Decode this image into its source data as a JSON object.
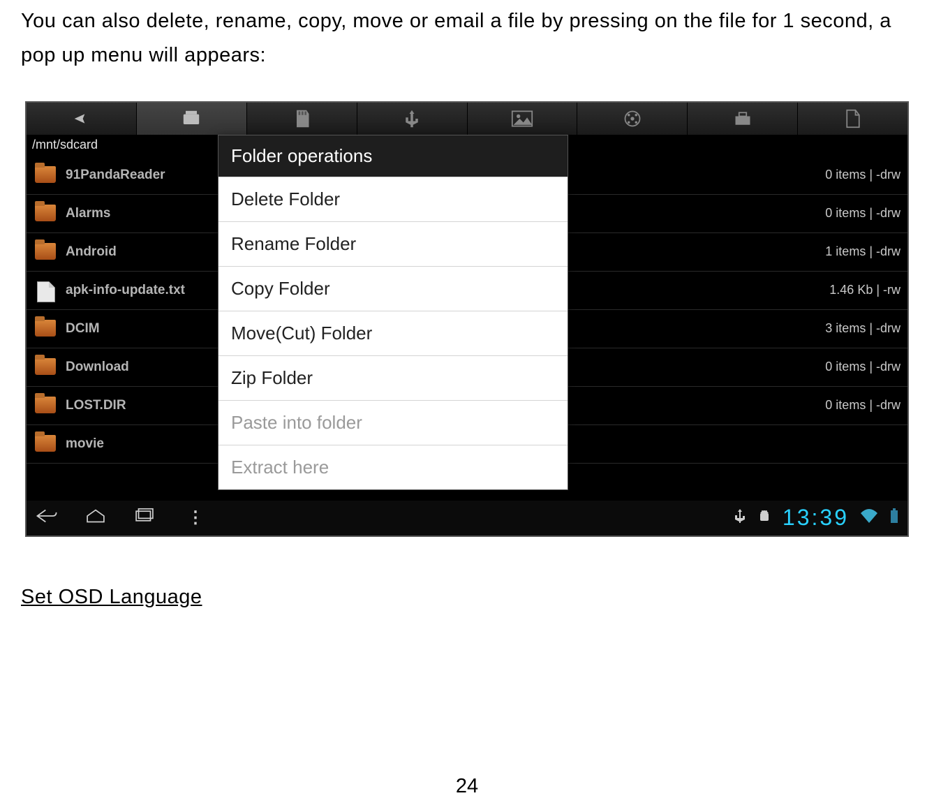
{
  "doc": {
    "body_text": "You can also delete, rename, copy, move or email a file by pressing on the file for 1 second, a pop up menu will appears:",
    "section_heading": "Set OSD Language",
    "page_number": "24"
  },
  "screenshot": {
    "path": "/mnt/sdcard",
    "clock": "13:39",
    "files": [
      {
        "name": "91PandaReader",
        "meta": "0 items | -drw",
        "type": "folder"
      },
      {
        "name": "Alarms",
        "meta": "0 items | -drw",
        "type": "folder"
      },
      {
        "name": "Android",
        "meta": "1 items | -drw",
        "type": "folder"
      },
      {
        "name": "apk-info-update.txt",
        "meta": "1.46 Kb  | -rw",
        "type": "file"
      },
      {
        "name": "DCIM",
        "meta": "3 items | -drw",
        "type": "folder"
      },
      {
        "name": "Download",
        "meta": "0 items | -drw",
        "type": "folder"
      },
      {
        "name": "LOST.DIR",
        "meta": "0 items | -drw",
        "type": "folder"
      },
      {
        "name": "movie",
        "meta": "",
        "type": "folder"
      }
    ],
    "popup": {
      "title": "Folder operations",
      "items": [
        {
          "label": "Delete Folder",
          "enabled": true
        },
        {
          "label": "Rename Folder",
          "enabled": true
        },
        {
          "label": "Copy Folder",
          "enabled": true
        },
        {
          "label": "Move(Cut) Folder",
          "enabled": true
        },
        {
          "label": "Zip Folder",
          "enabled": true
        },
        {
          "label": "Paste into folder",
          "enabled": false
        },
        {
          "label": "Extract here",
          "enabled": false
        }
      ]
    }
  }
}
